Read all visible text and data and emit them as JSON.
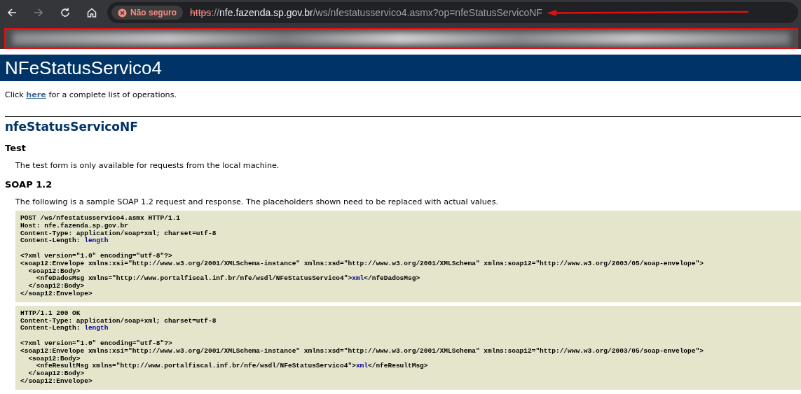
{
  "browser": {
    "security_badge": "Não seguro",
    "url": {
      "scheme": "https",
      "separator": "://",
      "host": "nfe.fazenda.sp.gov.br",
      "path": "/ws/nfestatusservico4.asmx?op=nfeStatusServicoNF"
    },
    "scheme_struck": true
  },
  "heading": "NFeStatusServico4",
  "intro": {
    "before": "Click ",
    "link": "here",
    "after": " for a complete list of operations."
  },
  "operation": "nfeStatusServicoNF",
  "sections": [
    {
      "title": "Test",
      "text": "The test form is only available for requests from the local machine."
    },
    {
      "title": "SOAP 1.2",
      "text": "The following is a sample SOAP 1.2 request and response. The placeholders shown need to be replaced with actual values.",
      "code_blocks": [
        [
          {
            "kind": "code",
            "segments": [
              {
                "text": "POST /ws/nfestatusservico4.asmx HTTP/1.1",
                "placeholder": false
              }
            ]
          },
          {
            "kind": "code",
            "segments": [
              {
                "text": "Host: nfe.fazenda.sp.gov.br",
                "placeholder": false
              }
            ]
          },
          {
            "kind": "code",
            "segments": [
              {
                "text": "Content-Type: application/soap+xml; charset=utf-8",
                "placeholder": false
              }
            ]
          },
          {
            "kind": "code",
            "segments": [
              {
                "text": "Content-Length: ",
                "placeholder": false
              },
              {
                "text": "length",
                "placeholder": true
              }
            ]
          },
          {
            "kind": "blank"
          },
          {
            "kind": "code",
            "segments": [
              {
                "text": "<?xml version=\"1.0\" encoding=\"utf-8\"?>",
                "placeholder": false
              }
            ]
          },
          {
            "kind": "code",
            "segments": [
              {
                "text": "<soap12:Envelope xmlns:xsi=\"http://www.w3.org/2001/XMLSchema-instance\" xmlns:xsd=\"http://www.w3.org/2001/XMLSchema\" xmlns:soap12=\"http://www.w3.org/2003/05/soap-envelope\">",
                "placeholder": false
              }
            ]
          },
          {
            "kind": "code",
            "segments": [
              {
                "text": "  <soap12:Body>",
                "placeholder": false
              }
            ]
          },
          {
            "kind": "code",
            "segments": [
              {
                "text": "    <nfeDadosMsg xmlns=\"http://www.portalfiscal.inf.br/nfe/wsdl/NFeStatusServico4\">",
                "placeholder": false
              },
              {
                "text": "xml",
                "placeholder": true
              },
              {
                "text": "</nfeDadosMsg>",
                "placeholder": false
              }
            ]
          },
          {
            "kind": "code",
            "segments": [
              {
                "text": "  </soap12:Body>",
                "placeholder": false
              }
            ]
          },
          {
            "kind": "code",
            "segments": [
              {
                "text": "</soap12:Envelope>",
                "placeholder": false
              }
            ]
          }
        ],
        [
          {
            "kind": "code",
            "segments": [
              {
                "text": "HTTP/1.1 200 OK",
                "placeholder": false
              }
            ]
          },
          {
            "kind": "code",
            "segments": [
              {
                "text": "Content-Type: application/soap+xml; charset=utf-8",
                "placeholder": false
              }
            ]
          },
          {
            "kind": "code",
            "segments": [
              {
                "text": "Content-Length: ",
                "placeholder": false
              },
              {
                "text": "length",
                "placeholder": true
              }
            ]
          },
          {
            "kind": "blank"
          },
          {
            "kind": "code",
            "segments": [
              {
                "text": "<?xml version=\"1.0\" encoding=\"utf-8\"?>",
                "placeholder": false
              }
            ]
          },
          {
            "kind": "code",
            "segments": [
              {
                "text": "<soap12:Envelope xmlns:xsi=\"http://www.w3.org/2001/XMLSchema-instance\" xmlns:xsd=\"http://www.w3.org/2001/XMLSchema\" xmlns:soap12=\"http://www.w3.org/2003/05/soap-envelope\">",
                "placeholder": false
              }
            ]
          },
          {
            "kind": "code",
            "segments": [
              {
                "text": "  <soap12:Body>",
                "placeholder": false
              }
            ]
          },
          {
            "kind": "code",
            "segments": [
              {
                "text": "    <nfeResultMsg xmlns=\"http://www.portalfiscal.inf.br/nfe/wsdl/NFeStatusServico4\">",
                "placeholder": false
              },
              {
                "text": "xml",
                "placeholder": true
              },
              {
                "text": "</nfeResultMsg>",
                "placeholder": false
              }
            ]
          },
          {
            "kind": "code",
            "segments": [
              {
                "text": "  </soap12:Body>",
                "placeholder": false
              }
            ]
          },
          {
            "kind": "code",
            "segments": [
              {
                "text": "</soap12:Envelope>",
                "placeholder": false
              }
            ]
          }
        ]
      ]
    }
  ]
}
